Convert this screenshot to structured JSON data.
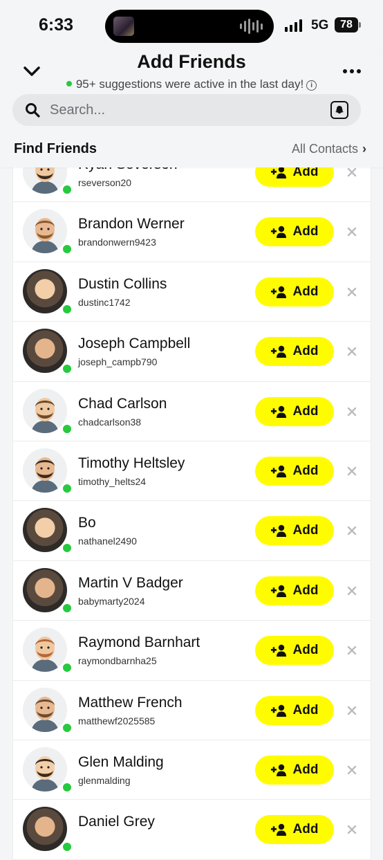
{
  "status_bar": {
    "time": "6:33",
    "network": "5G",
    "battery": "78"
  },
  "header": {
    "title": "Add Friends",
    "active_note": "95+ suggestions were active in the last day!",
    "search_placeholder": "Search...",
    "section_title": "Find Friends",
    "all_contacts": "All Contacts"
  },
  "add_label": "Add",
  "colors": {
    "accent": "#fffc00",
    "online": "#27c93f"
  },
  "friends": [
    {
      "name": "Ryan Severson",
      "username": "rseverson20",
      "avatar": "bitmoji"
    },
    {
      "name": "Brandon Werner",
      "username": "brandonwern9423",
      "avatar": "bitmoji"
    },
    {
      "name": "Dustin Collins",
      "username": "dustinc1742",
      "avatar": "photo"
    },
    {
      "name": "Joseph Campbell",
      "username": "joseph_campb790",
      "avatar": "photo"
    },
    {
      "name": "Chad Carlson",
      "username": "chadcarlson38",
      "avatar": "bitmoji"
    },
    {
      "name": "Timothy Heltsley",
      "username": "timothy_helts24",
      "avatar": "bitmoji"
    },
    {
      "name": "Bo",
      "username": "nathanel2490",
      "avatar": "photo"
    },
    {
      "name": "Martin V Badger",
      "username": "babymarty2024",
      "avatar": "photo"
    },
    {
      "name": "Raymond Barnhart",
      "username": "raymondbarnha25",
      "avatar": "bitmoji"
    },
    {
      "name": "Matthew French",
      "username": "matthewf2025585",
      "avatar": "bitmoji"
    },
    {
      "name": "Glen Malding",
      "username": "glenmalding",
      "avatar": "bitmoji"
    },
    {
      "name": "Daniel Grey",
      "username": "",
      "avatar": "photo"
    }
  ]
}
